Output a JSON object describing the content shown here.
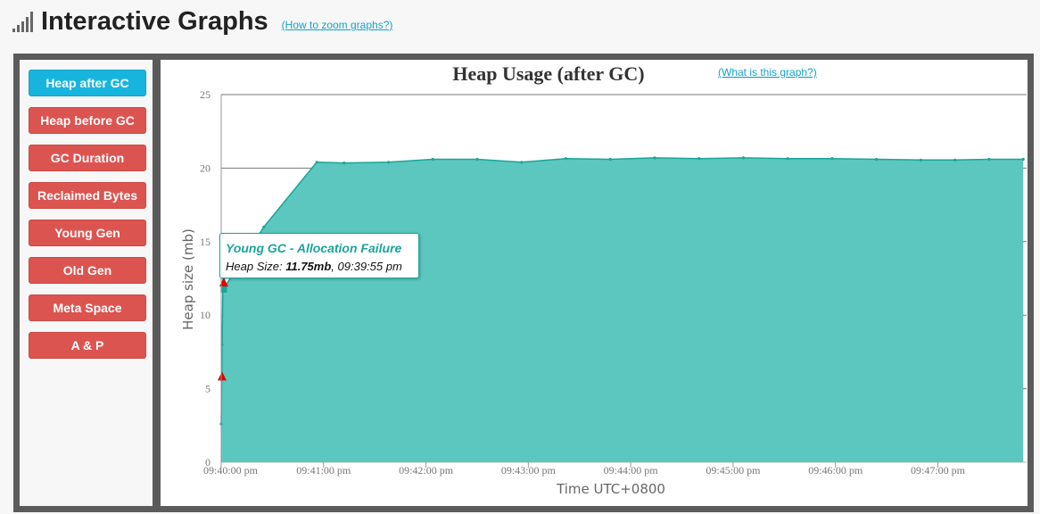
{
  "header": {
    "title": "Interactive Graphs",
    "help_link": "(How to zoom graphs?)"
  },
  "sidebar": {
    "items": [
      {
        "label": "Heap after GC",
        "active": true
      },
      {
        "label": "Heap before GC",
        "active": false
      },
      {
        "label": "GC Duration",
        "active": false
      },
      {
        "label": "Reclaimed Bytes",
        "active": false
      },
      {
        "label": "Young Gen",
        "active": false
      },
      {
        "label": "Old Gen",
        "active": false
      },
      {
        "label": "Meta Space",
        "active": false
      },
      {
        "label": "A & P",
        "active": false
      }
    ]
  },
  "tooltip": {
    "title": "Young GC - Allocation Failure",
    "label": "Heap Size:",
    "value": "11.75mb",
    "time": ", 09:39:55 pm"
  },
  "colors": {
    "area_fill": "#5bc7bf",
    "area_line": "#1aa59a",
    "marker": "#e00000",
    "active_button": "#17b5de",
    "button": "#dc5450"
  },
  "chart_data": {
    "type": "area",
    "title": "Heap Usage (after GC)",
    "help_link": "(What is this graph?)",
    "xlabel": "Time UTC+0800",
    "ylabel": "Heap size (mb)",
    "ylim": [
      0,
      25
    ],
    "yticks": [
      0,
      5,
      10,
      15,
      20,
      25
    ],
    "xlim": [
      "21:40:00",
      "21:47:52"
    ],
    "xticks": [
      {
        "t": "21:40:00",
        "label": "09:40:00 pm"
      },
      {
        "t": "21:41:00",
        "label": "09:41:00 pm"
      },
      {
        "t": "21:42:00",
        "label": "09:42:00 pm"
      },
      {
        "t": "21:43:00",
        "label": "09:43:00 pm"
      },
      {
        "t": "21:44:00",
        "label": "09:44:00 pm"
      },
      {
        "t": "21:45:00",
        "label": "09:45:00 pm"
      },
      {
        "t": "21:46:00",
        "label": "09:46:00 pm"
      },
      {
        "t": "21:47:00",
        "label": "09:47:00 pm"
      }
    ],
    "grid": true,
    "series": [
      {
        "points": [
          {
            "t": "21:40:00",
            "y": 2.6
          },
          {
            "t": "21:40:00.5",
            "y": 8.0
          },
          {
            "t": "21:40:01",
            "y": 12.0
          },
          {
            "t": "21:40:01.5",
            "y": 13.7
          },
          {
            "t": "21:40:02",
            "y": 11.9
          },
          {
            "t": "21:40:25",
            "y": 16.0
          },
          {
            "t": "21:40:56",
            "y": 20.4
          },
          {
            "t": "21:41:12",
            "y": 20.35
          },
          {
            "t": "21:41:38",
            "y": 20.4
          },
          {
            "t": "21:42:04",
            "y": 20.6
          },
          {
            "t": "21:42:30",
            "y": 20.6
          },
          {
            "t": "21:42:56",
            "y": 20.4
          },
          {
            "t": "21:43:22",
            "y": 20.65
          },
          {
            "t": "21:43:48",
            "y": 20.6
          },
          {
            "t": "21:44:14",
            "y": 20.7
          },
          {
            "t": "21:44:40",
            "y": 20.65
          },
          {
            "t": "21:45:06",
            "y": 20.7
          },
          {
            "t": "21:45:32",
            "y": 20.65
          },
          {
            "t": "21:45:58",
            "y": 20.65
          },
          {
            "t": "21:46:24",
            "y": 20.6
          },
          {
            "t": "21:46:50",
            "y": 20.55
          },
          {
            "t": "21:47:10",
            "y": 20.55
          },
          {
            "t": "21:47:30",
            "y": 20.6
          },
          {
            "t": "21:47:50",
            "y": 20.6
          }
        ]
      }
    ],
    "markers": [
      {
        "t": "21:40:00.5",
        "y": 5.8
      },
      {
        "t": "21:40:01.5",
        "y": 12.2
      }
    ],
    "highlight": {
      "t": "21:40:01.5",
      "y": 11.75
    }
  }
}
